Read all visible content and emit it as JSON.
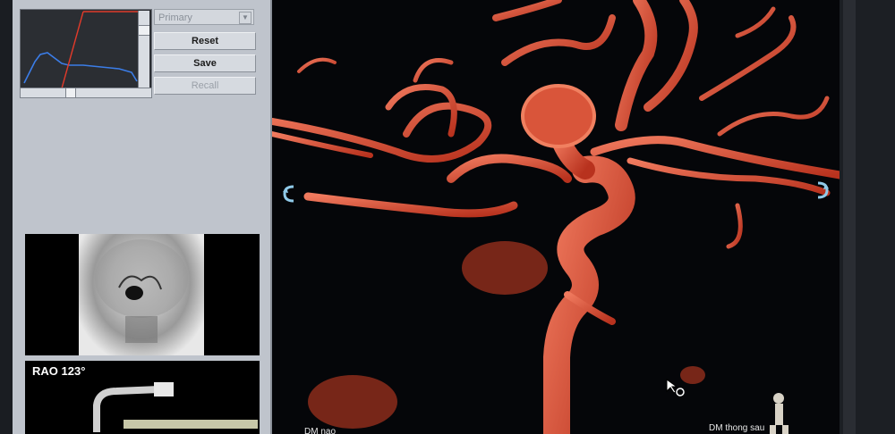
{
  "controls": {
    "layer_select": "Primary",
    "reset_label": "Reset",
    "save_label": "Save",
    "recall_label": "Recall"
  },
  "geometry": {
    "angle_label": "RAO 123°"
  },
  "viewer": {
    "label_bottom_right": "DM thong sau",
    "label_bottom_left": "DM nao"
  },
  "colors": {
    "vessel": "#e0523a",
    "histogram_curve": "#3b7de8",
    "histogram_line": "#e03a2a"
  }
}
